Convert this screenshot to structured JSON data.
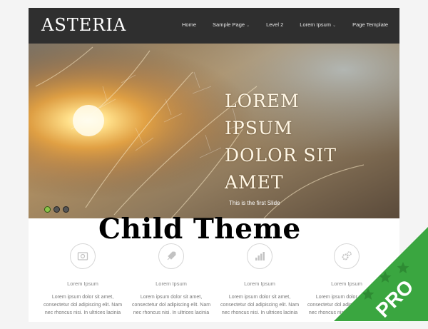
{
  "header": {
    "logo": "ASTERIA",
    "nav": [
      {
        "label": "Home",
        "dropdown": false
      },
      {
        "label": "Sample Page",
        "dropdown": true
      },
      {
        "label": "Level 2",
        "dropdown": false
      },
      {
        "label": "Lorem Ipsum",
        "dropdown": true
      },
      {
        "label": "Page Template",
        "dropdown": false
      }
    ]
  },
  "slider": {
    "heading": [
      "LOREM",
      "IPSUM",
      "DOLOR SIT",
      "AMET"
    ],
    "caption": "This is the first Slide",
    "slide_count": 3,
    "active_slide": 1
  },
  "overlay": {
    "title": "Child Theme",
    "badge": "PRO",
    "badge_color": "#3aa640",
    "star_color": "#2e8b33"
  },
  "features": [
    {
      "icon": "photo-icon",
      "title": "Lorem Ipsum",
      "lines": [
        "Lorem ipsum dolor sit amet,",
        "consectetur dol adipiscing elit. Nam",
        "nec rhoncus nisi. In ultrices lacinia"
      ]
    },
    {
      "icon": "rocket-icon",
      "title": "Lorem Ipsum",
      "lines": [
        "Lorem ipsum dolor sit amet,",
        "consectetur dol adipiscing elit. Nam",
        "nec rhoncus nisi. In ultrices lacinia"
      ]
    },
    {
      "icon": "bar-chart-icon",
      "title": "Lorem Ipsum",
      "lines": [
        "Lorem ipsum dolor sit amet,",
        "consectetur dol adipiscing elit. Nam",
        "nec rhoncus nisi. In ultrices lacinia"
      ]
    },
    {
      "icon": "gears-icon",
      "title": "Lorem Ipsum",
      "lines": [
        "Lorem ipsum dolor sit amet,",
        "consectetur dol adipiscing elit. Nam",
        "nec rhoncus nisi. In ultrices lacinia"
      ]
    }
  ],
  "colors": {
    "header_bg": "#2f2f2f",
    "active_dot": "#8bc34a",
    "page_bg": "#f4f4f4"
  }
}
